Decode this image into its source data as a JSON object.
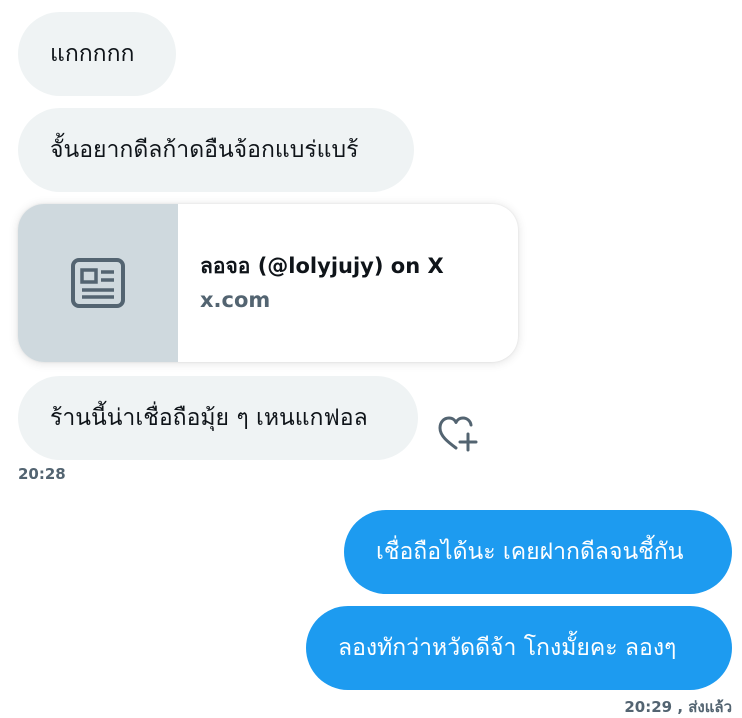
{
  "colors": {
    "incoming_bubble": "#eff3f4",
    "outgoing_bubble": "#1d9bf0",
    "meta_text": "#536471",
    "card_thumbnail": "#cfd9de"
  },
  "messages": [
    {
      "direction": "incoming",
      "text": "แกกกกก"
    },
    {
      "direction": "incoming",
      "text": "จั้นอยากดีลก้าดอืนจ้อกแบร่แบร้"
    },
    {
      "direction": "incoming",
      "text": "ร้านนี้น่าเชื่อถือมุ้ย ๆ เหนแกฟอล"
    },
    {
      "direction": "outgoing",
      "text": "เชื่อถือได้นะ เคยฝากดีลจนชี้กัน"
    },
    {
      "direction": "outgoing",
      "text": "ลองทักว่าหวัดดีจ้า โกงมั้ยคะ ลองๆ"
    }
  ],
  "link_card": {
    "icon": "article-icon",
    "title": "ลอจอ (@lolyjujy) on X",
    "domain": "x.com"
  },
  "reaction_button": {
    "icon": "heart-plus-icon"
  },
  "incoming_time": "20:28",
  "outgoing_status": "20:29 , ส่งแล้ว"
}
